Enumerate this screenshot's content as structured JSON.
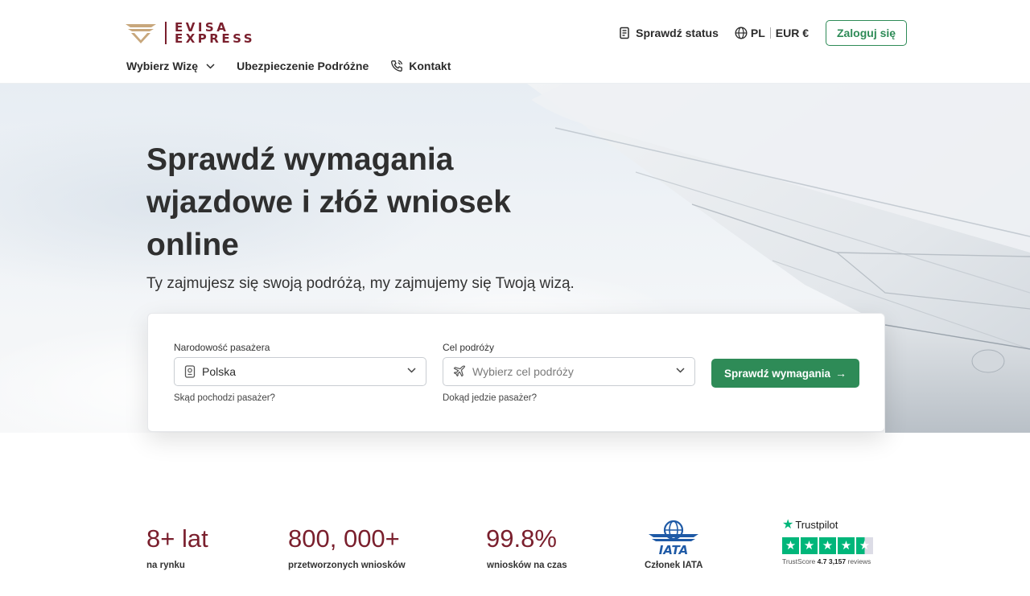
{
  "brand": {
    "line1": "EVISA",
    "line2": "EXPRESS",
    "color": "#7a1f2d",
    "accent": "#2e8b57"
  },
  "header": {
    "status_label": "Sprawdź status",
    "lang": "PL",
    "currency": "EUR €",
    "login_label": "Zaloguj się"
  },
  "nav": {
    "visa_label": "Wybierz Wizę",
    "insurance_label": "Ubezpieczenie Podróżne",
    "contact_label": "Kontakt"
  },
  "hero": {
    "title": "Sprawdź wymagania wjazdowe i złóż wniosek online",
    "subtitle": "Ty zajmujesz się swoją podróżą, my zajmujemy się Twoją wizą."
  },
  "search": {
    "nationality_label": "Narodowość pasażera",
    "nationality_value": "Polska",
    "nationality_hint": "Skąd pochodzi pasażer?",
    "destination_label": "Cel podróży",
    "destination_placeholder": "Wybierz cel podróży",
    "destination_hint": "Dokąd jedzie pasażer?",
    "submit_label": "Sprawdź wymagania",
    "submit_arrow": "→"
  },
  "stats": [
    {
      "value": "8+ lat",
      "label": "na rynku"
    },
    {
      "value": "800, 000+",
      "label": "przetworzonych wniosków"
    },
    {
      "value": "99.8%",
      "label": "wniosków na czas"
    }
  ],
  "iata": {
    "logo_text": "IATA",
    "label": "Członek IATA"
  },
  "trustpilot": {
    "brand": "Trustpilot",
    "score_prefix": "TrustScore",
    "score": "4.7",
    "reviews_count": "3,157",
    "reviews_suffix": "reviews",
    "stars": 4.5
  }
}
